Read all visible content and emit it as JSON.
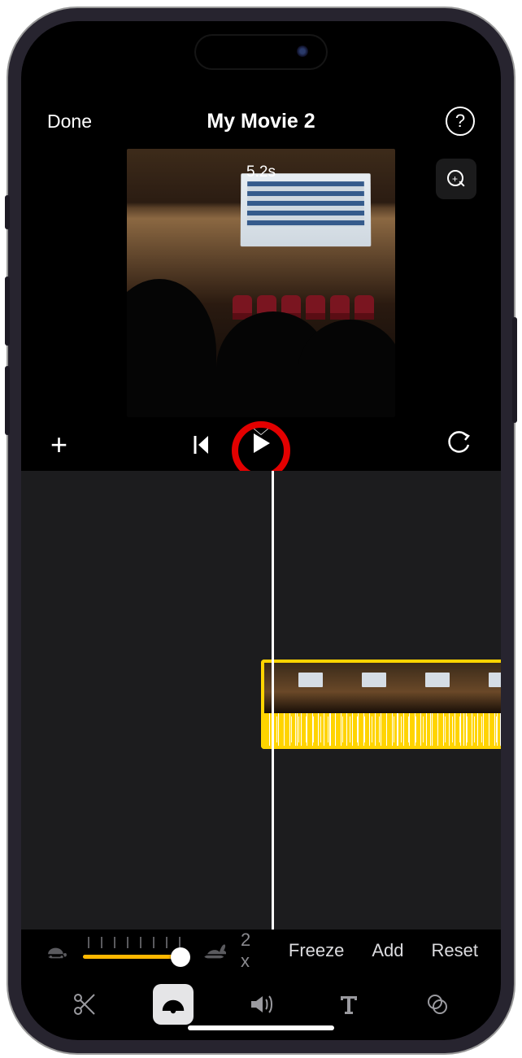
{
  "header": {
    "done_label": "Done",
    "title": "My Movie 2",
    "help_label": "?"
  },
  "preview": {
    "duration_label": "5.2s"
  },
  "speed": {
    "multiplier_label": "2 x",
    "freeze_label": "Freeze",
    "add_label": "Add",
    "reset_label": "Reset"
  },
  "icons": {
    "zoom": "zoom-in",
    "plus": "add",
    "skip": "skip-start",
    "play": "play",
    "undo": "undo",
    "turtle": "slow",
    "rabbit": "fast",
    "scissors": "cut-tab",
    "speedometer": "speed-tab",
    "volume": "volume-tab",
    "text": "title-tab",
    "filters": "filters-tab"
  }
}
